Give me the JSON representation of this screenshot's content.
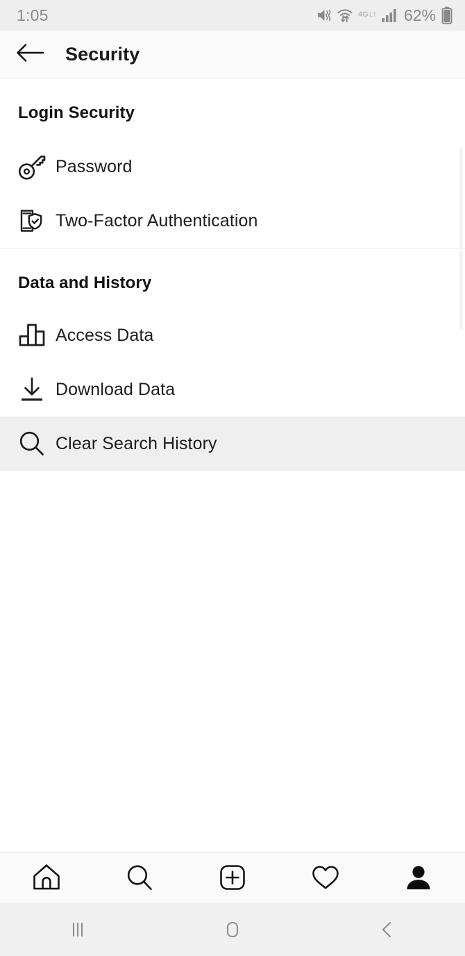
{
  "status_bar": {
    "time": "1:05",
    "battery_percent": "62%",
    "icons": [
      "mute-vibrate-icon",
      "wifi-data-transfer-icon",
      "4g-lte-icon",
      "cellular-signal-icon",
      "battery-icon"
    ]
  },
  "app_bar": {
    "back_icon": "arrow-left-icon",
    "title": "Security"
  },
  "sections": [
    {
      "title": "Login Security",
      "rows": [
        {
          "icon": "key-icon",
          "label": "Password",
          "pressed": false
        },
        {
          "icon": "phone-shield-check-icon",
          "label": "Two-Factor Authentication",
          "pressed": false
        }
      ]
    },
    {
      "title": "Data and History",
      "rows": [
        {
          "icon": "bar-chart-icon",
          "label": "Access Data",
          "pressed": false
        },
        {
          "icon": "download-icon",
          "label": "Download Data",
          "pressed": false
        },
        {
          "icon": "search-icon",
          "label": "Clear Search History",
          "pressed": true
        }
      ]
    }
  ],
  "tab_bar": {
    "items": [
      {
        "icon": "home-icon",
        "label": "Home",
        "active": false
      },
      {
        "icon": "search-icon",
        "label": "Search",
        "active": false
      },
      {
        "icon": "add-post-icon",
        "label": "New Post",
        "active": false
      },
      {
        "icon": "heart-icon",
        "label": "Activity",
        "active": false
      },
      {
        "icon": "profile-icon",
        "label": "Profile",
        "active": true
      }
    ]
  },
  "system_nav": {
    "items": [
      {
        "icon": "recents-icon",
        "label": "Recents"
      },
      {
        "icon": "home-square-icon",
        "label": "Home"
      },
      {
        "icon": "back-chevron-icon",
        "label": "Back"
      }
    ]
  },
  "colors": {
    "status_bar_bg": "#eeeeee",
    "app_bar_bg": "#fafafa",
    "content_bg": "#ffffff",
    "pressed_row_bg": "#efefef",
    "system_nav_bg": "#f0f0f0",
    "text_primary": "#1a1a1a",
    "status_text": "#8a8a8a"
  }
}
